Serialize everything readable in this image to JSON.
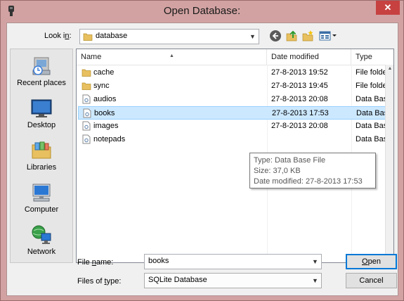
{
  "window": {
    "title": "Open Database:",
    "close_glyph": "✕"
  },
  "lookin": {
    "label": "Look in:",
    "value": "database"
  },
  "toolbar": {
    "back_icon": "back-icon",
    "up_icon": "up-folder-icon",
    "newfolder_icon": "new-folder-icon",
    "views_icon": "view-menu-icon"
  },
  "places": [
    {
      "label": "Recent places",
      "icon": "recent-places-icon"
    },
    {
      "label": "Desktop",
      "icon": "desktop-icon"
    },
    {
      "label": "Libraries",
      "icon": "libraries-icon"
    },
    {
      "label": "Computer",
      "icon": "computer-icon"
    },
    {
      "label": "Network",
      "icon": "network-icon"
    }
  ],
  "columns": {
    "name": "Name",
    "date": "Date modified",
    "type": "Type"
  },
  "files": [
    {
      "name": "cache",
      "date": "27-8-2013 19:52",
      "type": "File folder",
      "kind": "folder"
    },
    {
      "name": "sync",
      "date": "27-8-2013 19:45",
      "type": "File folder",
      "kind": "folder"
    },
    {
      "name": "audios",
      "date": "27-8-2013 20:08",
      "type": "Data Base",
      "kind": "db"
    },
    {
      "name": "books",
      "date": "27-8-2013 17:53",
      "type": "Data Base",
      "kind": "db",
      "selected": true
    },
    {
      "name": "images",
      "date": "27-8-2013 20:08",
      "type": "Data Base",
      "kind": "db"
    },
    {
      "name": "notepads",
      "date": "",
      "type": "Data Base",
      "kind": "db"
    }
  ],
  "tooltip": {
    "type_line": "Type: Data Base File",
    "size_line": "Size: 37,0 KB",
    "date_line": "Date modified: 27-8-2013 17:53"
  },
  "filename": {
    "label_pre": "File ",
    "label_u": "n",
    "label_post": "ame:",
    "value": "books"
  },
  "filetype": {
    "label_pre": "Files of ",
    "label_u": "t",
    "label_post": "ype:",
    "value": "SQLite Database"
  },
  "buttons": {
    "open_u": "O",
    "open_rest": "pen",
    "cancel": "Cancel"
  },
  "colors": {
    "frame": "#d2a2a2",
    "close": "#c74141",
    "selection": "#cce8ff",
    "selection_border": "#99d1ff",
    "accent": "#0078d7"
  }
}
